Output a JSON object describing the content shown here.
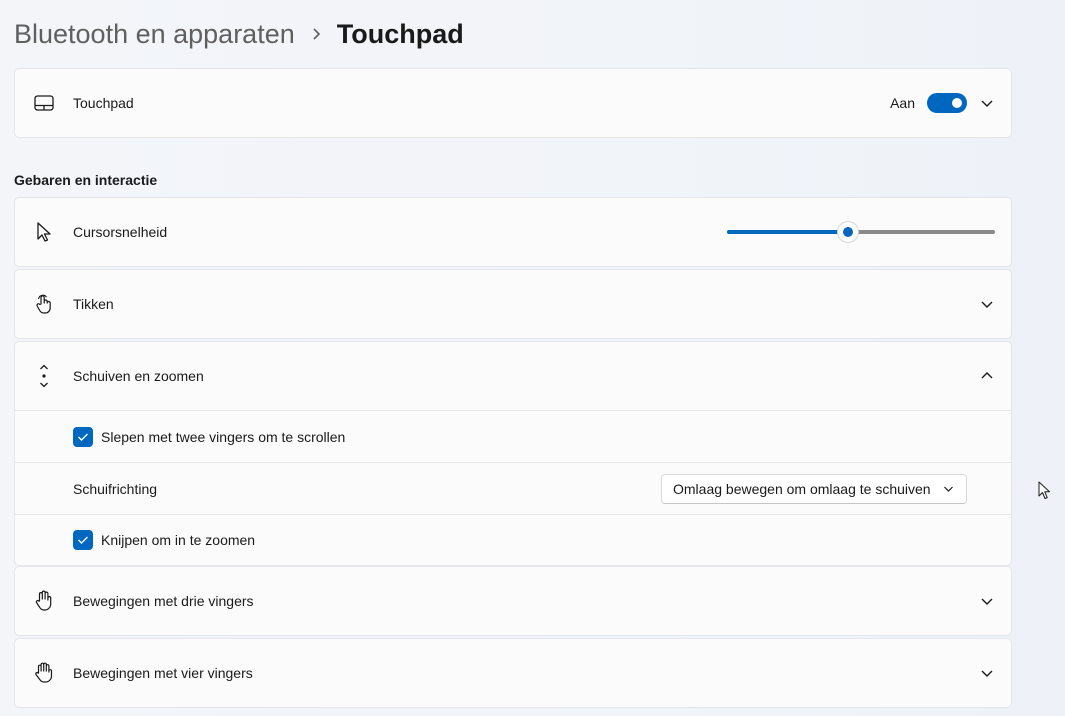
{
  "breadcrumb": {
    "parent": "Bluetooth en apparaten",
    "current": "Touchpad"
  },
  "touchpad": {
    "label": "Touchpad",
    "toggle_state_text": "Aan",
    "toggle_on": true,
    "icon": "touchpad-icon"
  },
  "section": {
    "title": "Gebaren en interactie"
  },
  "cursor_speed": {
    "label": "Cursorsnelheid",
    "value_fraction": 0.45,
    "icon": "cursor-icon"
  },
  "tap": {
    "label": "Tikken",
    "icon": "tap-hand-icon"
  },
  "scroll_zoom": {
    "label": "Schuiven en zoomen",
    "icon": "scroll-zoom-icon",
    "two_finger_scroll": {
      "label": "Slepen met twee vingers om te scrollen",
      "checked": true
    },
    "scroll_direction": {
      "label": "Schuifrichting",
      "selected": "Omlaag bewegen om omlaag te schuiven"
    },
    "pinch_zoom": {
      "label": "Knijpen om in te zoomen",
      "checked": true
    }
  },
  "three_finger": {
    "label": "Bewegingen met drie vingers",
    "icon": "three-finger-hand-icon"
  },
  "four_finger": {
    "label": "Bewegingen met vier vingers",
    "icon": "four-finger-hand-icon"
  },
  "colors": {
    "accent": "#0067c0"
  }
}
